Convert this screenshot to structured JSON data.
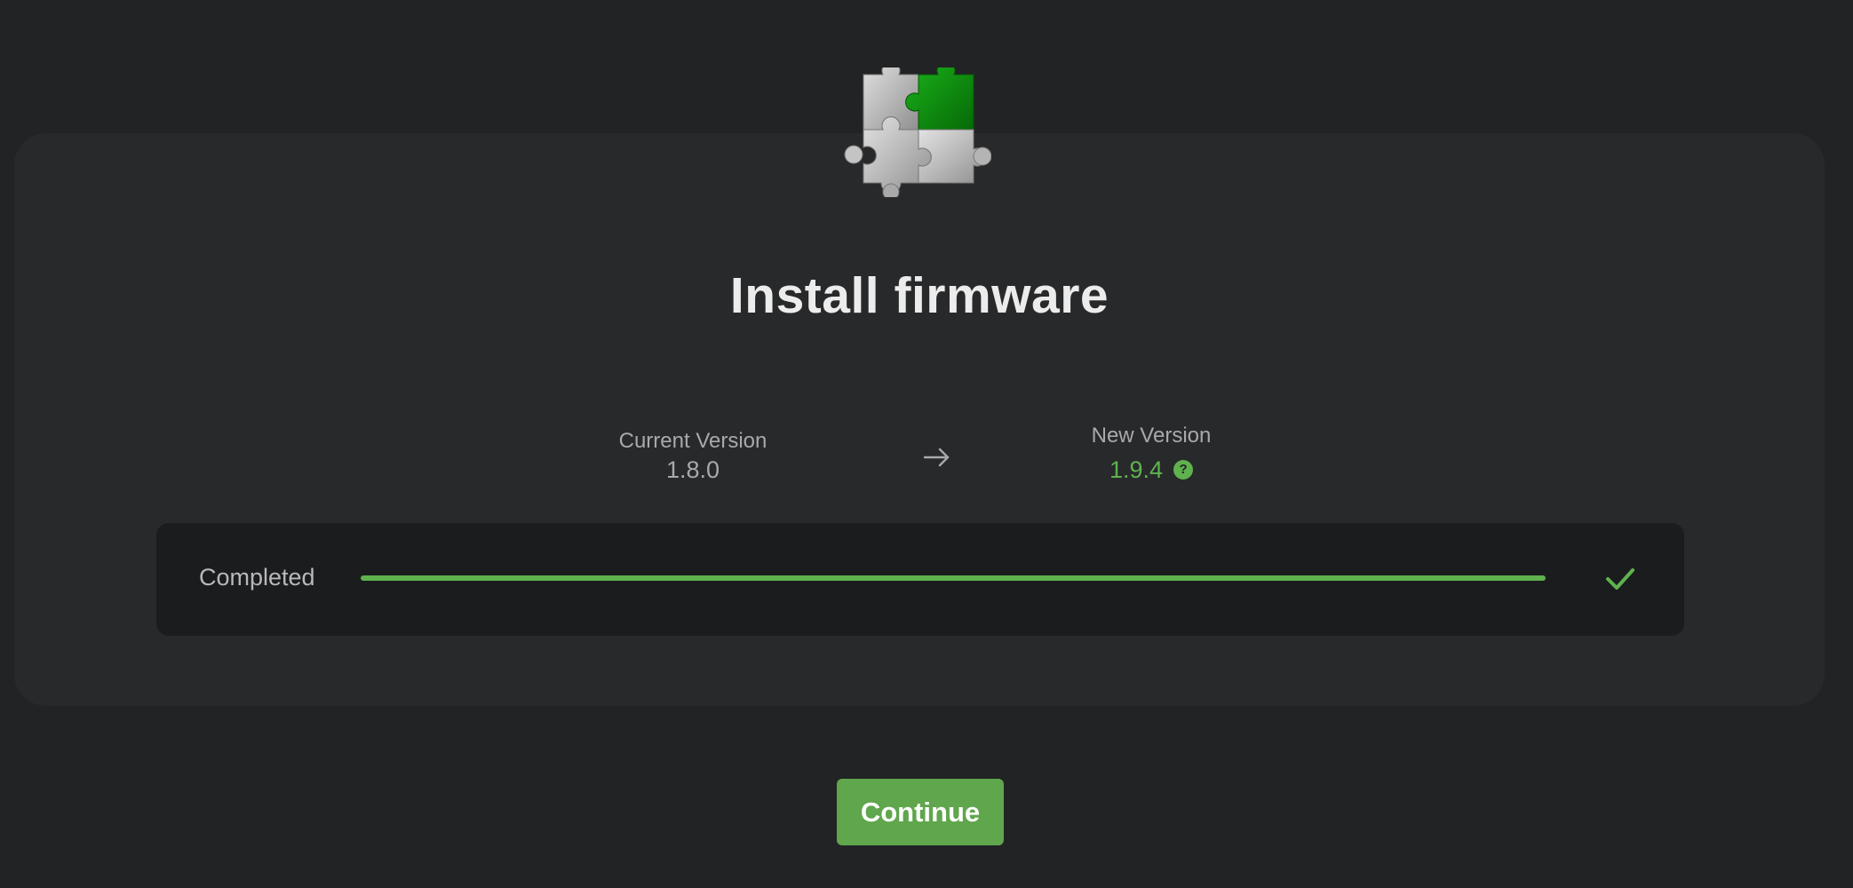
{
  "header": {
    "title": "Install firmware",
    "logo_icon": "puzzle-pieces-icon"
  },
  "versions": {
    "current_label": "Current Version",
    "current_value": "1.8.0",
    "arrow_icon": "arrow-right-icon",
    "new_label": "New Version",
    "new_value": "1.9.4",
    "help_icon": "question-mark-icon",
    "help_glyph": "?"
  },
  "progress": {
    "status_label": "Completed",
    "fraction": 1.0,
    "status_icon": "checkmark-icon"
  },
  "actions": {
    "continue_label": "Continue"
  },
  "colors": {
    "accent": "#5fb24e",
    "button": "#5fa64c",
    "background": "#222325",
    "card": "#28292b",
    "panel": "#1b1c1e",
    "puzzle_green": "#0f9a0f"
  }
}
